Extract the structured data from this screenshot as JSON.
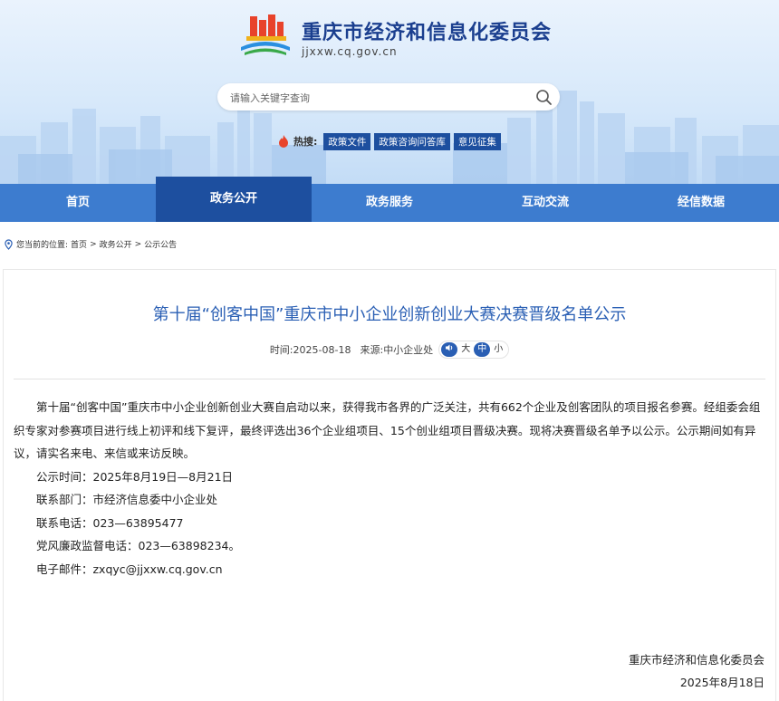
{
  "header": {
    "site_title": "重庆市经济和信息化委员会",
    "site_domain": "jjxxw.cq.gov.cn",
    "search_placeholder": "请输入关键字查询",
    "hot_label": "热搜:",
    "hot_tags": [
      "政策文件",
      "政策咨询问答库",
      "意见征集"
    ]
  },
  "nav": {
    "items": [
      "首页",
      "政务公开",
      "政务服务",
      "互动交流",
      "经信数据"
    ],
    "active": "政务公开"
  },
  "breadcrumb": {
    "prefix": "您当前的位置:",
    "items": [
      "首页",
      "政务公开",
      "公示公告"
    ],
    "sep": ">"
  },
  "article": {
    "title": "第十届“创客中国”重庆市中小企业创新创业大赛决赛晋级名单公示",
    "time_label": "时间:",
    "time": "2025-08-18",
    "source_label": "来源:",
    "source": "中小企业处",
    "font_sizes": [
      "大",
      "中",
      "小"
    ],
    "paragraph": "第十届“创客中国”重庆市中小企业创新创业大赛自启动以来，获得我市各界的广泛关注，共有662个企业及创客团队的项目报名参赛。经组委会组织专家对参赛项目进行线上初评和线下复评，最终评选出36个企业组项目、15个创业组项目晋级决赛。现将决赛晋级名单予以公示。公示期间如有异议，请实名来电、来信或来访反映。",
    "lines": [
      "公示时间：2025年8月19日—8月21日",
      "联系部门：市经济信息委中小企业处",
      "联系电话：023—63895477",
      "党风廉政监督电话：023—63898234。",
      "电子邮件：zxqyc@jjxxw.cq.gov.cn"
    ],
    "signature": "重庆市经济和信息化委员会",
    "date": "2025年8月18日"
  },
  "colors": {
    "nav_bg": "#3d7ccf",
    "nav_active": "#1d4f9f",
    "title_blue": "#2a5fb4"
  }
}
